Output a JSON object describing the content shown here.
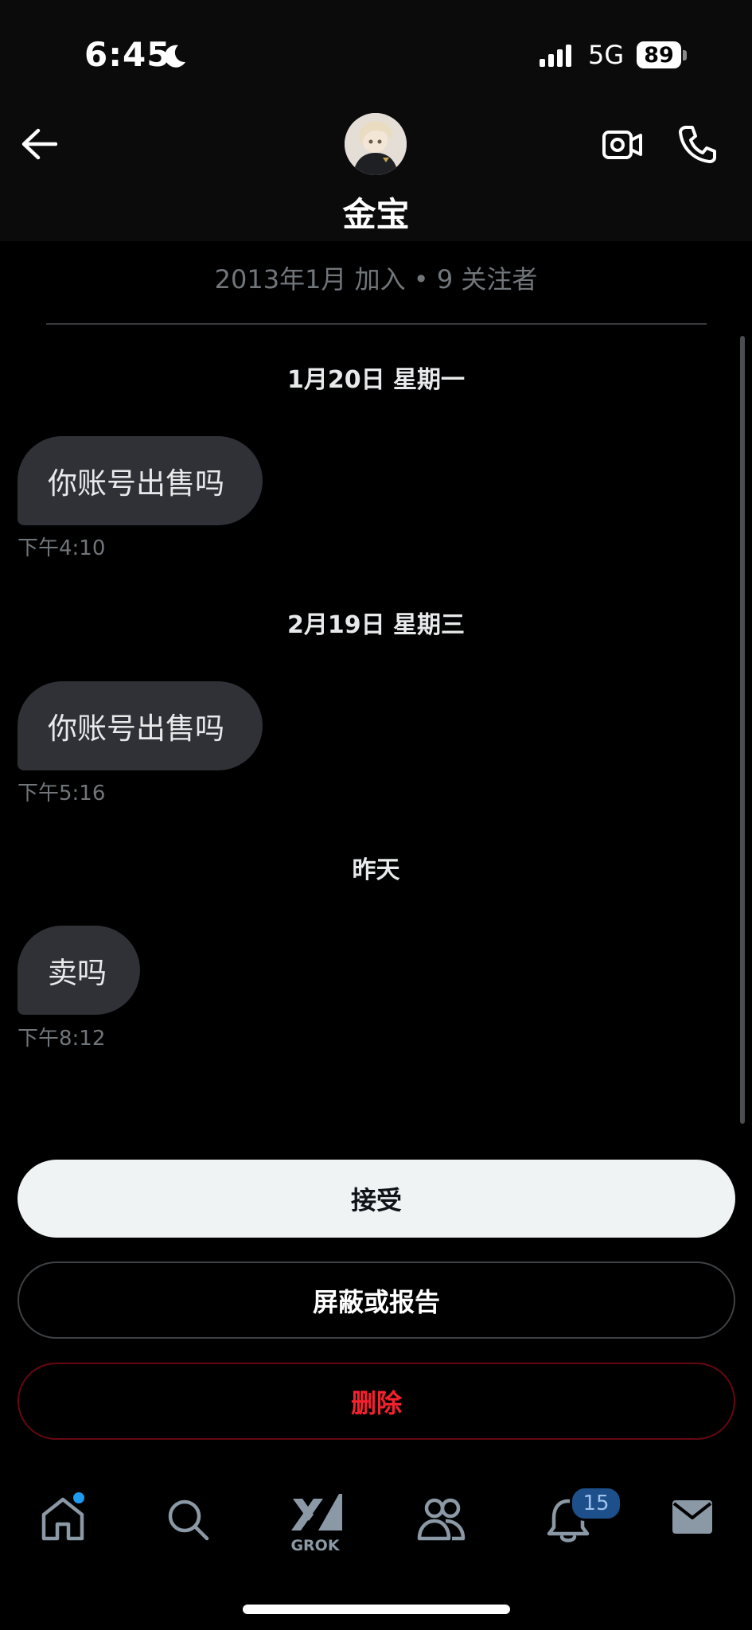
{
  "status_bar": {
    "time": "6:45",
    "network": "5G",
    "battery": "89"
  },
  "header": {
    "name": "金宝"
  },
  "profile_info": "2013年1月 加入 • 9 关注者",
  "conversation": [
    {
      "date": "1月20日 星期一",
      "message": "你账号出售吗",
      "time": "下午4:10"
    },
    {
      "date": "2月19日 星期三",
      "message": "你账号出售吗",
      "time": "下午5:16"
    },
    {
      "date": "昨天",
      "message": "卖吗",
      "time": "下午8:12"
    }
  ],
  "actions": {
    "accept": "接受",
    "block_or_report": "屏蔽或报告",
    "delete": "删除"
  },
  "nav": {
    "items": [
      "home-icon",
      "search-icon",
      "grok-icon",
      "communities-icon",
      "notifications-icon",
      "messages-icon"
    ],
    "grok_label": "GROK",
    "notification_count": "15"
  },
  "colors": {
    "background": "#000000",
    "bubble": "#2f3136",
    "accent": "#1d9bf0",
    "delete": "#f4212e"
  }
}
